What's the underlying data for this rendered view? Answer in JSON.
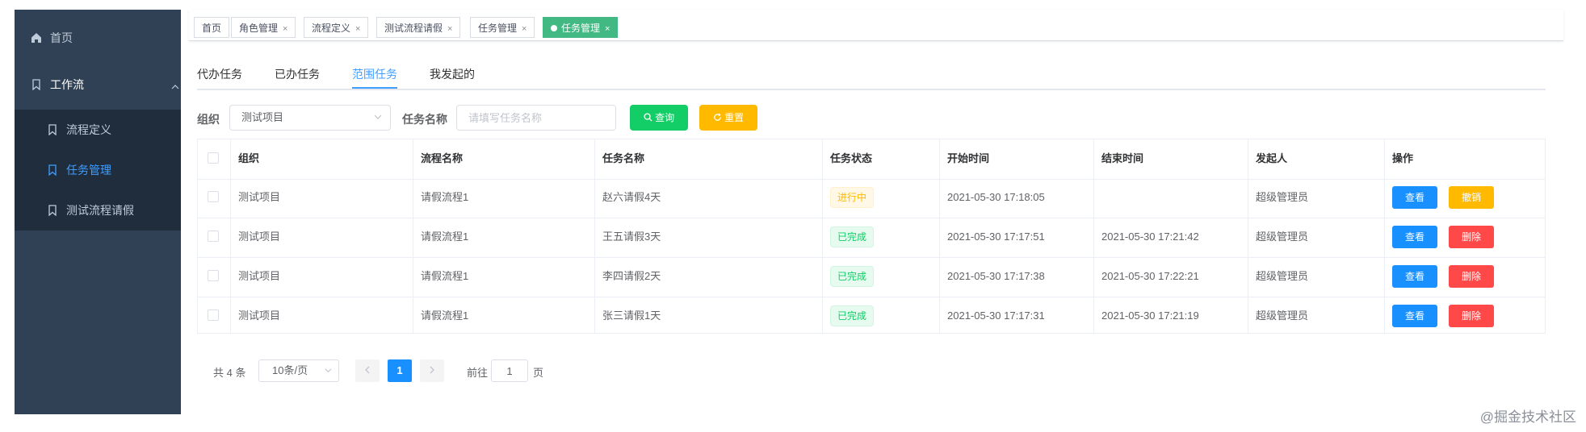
{
  "sidebar": {
    "home": "首页",
    "workflow": "工作流",
    "items": [
      "流程定义",
      "任务管理",
      "测试流程请假"
    ]
  },
  "tags": [
    "首页",
    "角色管理",
    "流程定义",
    "测试流程请假",
    "任务管理",
    "任务管理"
  ],
  "tabs": [
    "代办任务",
    "已办任务",
    "范围任务",
    "我发起的"
  ],
  "filter": {
    "org_label": "组织",
    "org_value": "测试项目",
    "task_label": "任务名称",
    "task_placeholder": "请填写任务名称",
    "query": "查询",
    "reset": "重置"
  },
  "table": {
    "headers": [
      "组织",
      "流程名称",
      "任务名称",
      "任务状态",
      "开始时间",
      "结束时间",
      "发起人",
      "操作"
    ],
    "rows": [
      {
        "org": "测试项目",
        "process": "请假流程1",
        "task": "赵六请假4天",
        "status": "进行中",
        "start": "2021-05-30 17:18:05",
        "end": "",
        "initiator": "超级管理员",
        "action1": "查看",
        "action2": "撤销"
      },
      {
        "org": "测试项目",
        "process": "请假流程1",
        "task": "王五请假3天",
        "status": "已完成",
        "start": "2021-05-30 17:17:51",
        "end": "2021-05-30 17:21:42",
        "initiator": "超级管理员",
        "action1": "查看",
        "action2": "删除"
      },
      {
        "org": "测试项目",
        "process": "请假流程1",
        "task": "李四请假2天",
        "status": "已完成",
        "start": "2021-05-30 17:17:38",
        "end": "2021-05-30 17:22:21",
        "initiator": "超级管理员",
        "action1": "查看",
        "action2": "删除"
      },
      {
        "org": "测试项目",
        "process": "请假流程1",
        "task": "张三请假1天",
        "status": "已完成",
        "start": "2021-05-30 17:17:31",
        "end": "2021-05-30 17:21:19",
        "initiator": "超级管理员",
        "action1": "查看",
        "action2": "删除"
      }
    ]
  },
  "pagination": {
    "total": "共 4 条",
    "page_size": "10条/页",
    "current": "1",
    "goto_label": "前往",
    "goto_value": "1",
    "page_unit": "页"
  },
  "watermark": "@掘金技术社区",
  "colors": {
    "sidebar_bg": "#304156",
    "active_tag": "#42b983",
    "primary": "#1890ff",
    "success": "#13ce66",
    "warning": "#ffba00",
    "danger": "#ff4949"
  }
}
